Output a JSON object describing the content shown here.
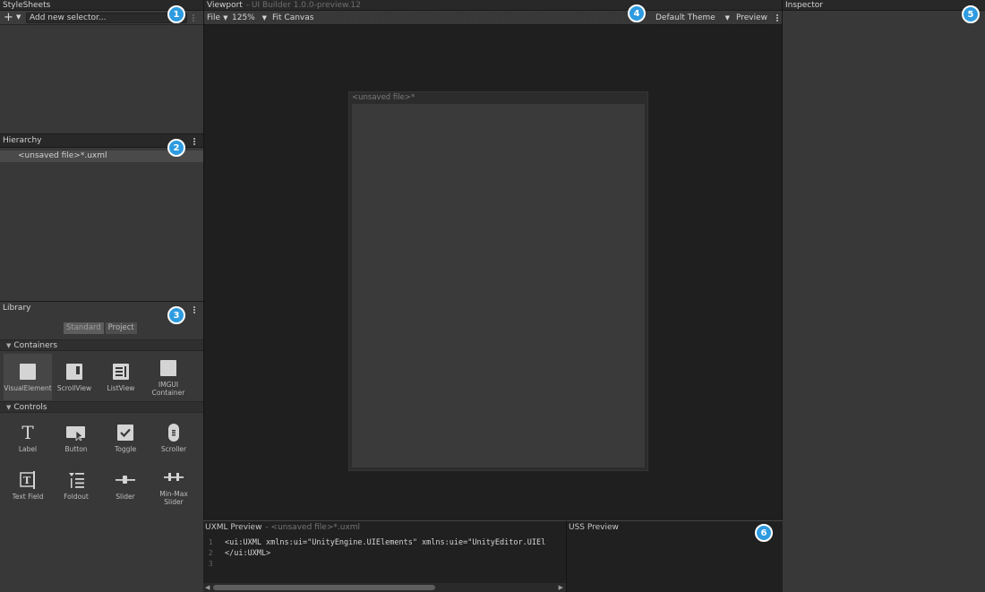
{
  "stylesheets": {
    "title": "StyleSheets",
    "add_icon": "plus-icon",
    "selector_placeholder": "Add new selector...",
    "badge": "1"
  },
  "hierarchy": {
    "title": "Hierarchy",
    "items": [
      "<unsaved file>*.uxml"
    ],
    "badge": "2"
  },
  "library": {
    "title": "Library",
    "badge": "3",
    "tabs": [
      "Standard",
      "Project"
    ],
    "sections": [
      {
        "label": "Containers",
        "items": [
          {
            "label": "VisualElement",
            "icon": "visual-element-icon",
            "selected": true
          },
          {
            "label": "ScrollView",
            "icon": "scrollview-icon"
          },
          {
            "label": "ListView",
            "icon": "listview-icon"
          },
          {
            "label": "IMGUI Container",
            "icon": "imgui-container-icon"
          }
        ]
      },
      {
        "label": "Controls",
        "items": [
          {
            "label": "Label",
            "icon": "label-icon"
          },
          {
            "label": "Button",
            "icon": "button-icon"
          },
          {
            "label": "Toggle",
            "icon": "toggle-icon"
          },
          {
            "label": "Scroller",
            "icon": "scroller-icon"
          },
          {
            "label": "Text Field",
            "icon": "text-field-icon"
          },
          {
            "label": "Foldout",
            "icon": "foldout-icon"
          },
          {
            "label": "Slider",
            "icon": "slider-icon"
          },
          {
            "label": "Min-Max Slider",
            "icon": "min-max-slider-icon"
          }
        ]
      }
    ]
  },
  "viewport": {
    "title": "Viewport",
    "subtitle": "- UI Builder 1.0.0-preview.12",
    "badge": "4",
    "toolbar": {
      "file": "File",
      "zoom": "125%",
      "fit_canvas": "Fit Canvas",
      "theme": "Default Theme",
      "preview": "Preview"
    },
    "canvas_title": "<unsaved file>*"
  },
  "inspector": {
    "title": "Inspector",
    "badge": "5"
  },
  "uxml_preview": {
    "title": "UXML Preview",
    "subtitle": "- <unsaved file>*.uxml",
    "lines": [
      {
        "num": "1",
        "text": "<ui:UXML xmlns:ui=\"UnityEngine.UIElements\" xmlns:uie=\"UnityEditor.UIEl"
      },
      {
        "num": "2",
        "text": "</ui:UXML>"
      },
      {
        "num": "3",
        "text": ""
      }
    ]
  },
  "uss_preview": {
    "title": "USS Preview",
    "badge": "6"
  },
  "colors": {
    "panel": "#383838",
    "header": "#282828",
    "viewport_bg": "#1f1f1f",
    "badge": "#2e9be0"
  }
}
